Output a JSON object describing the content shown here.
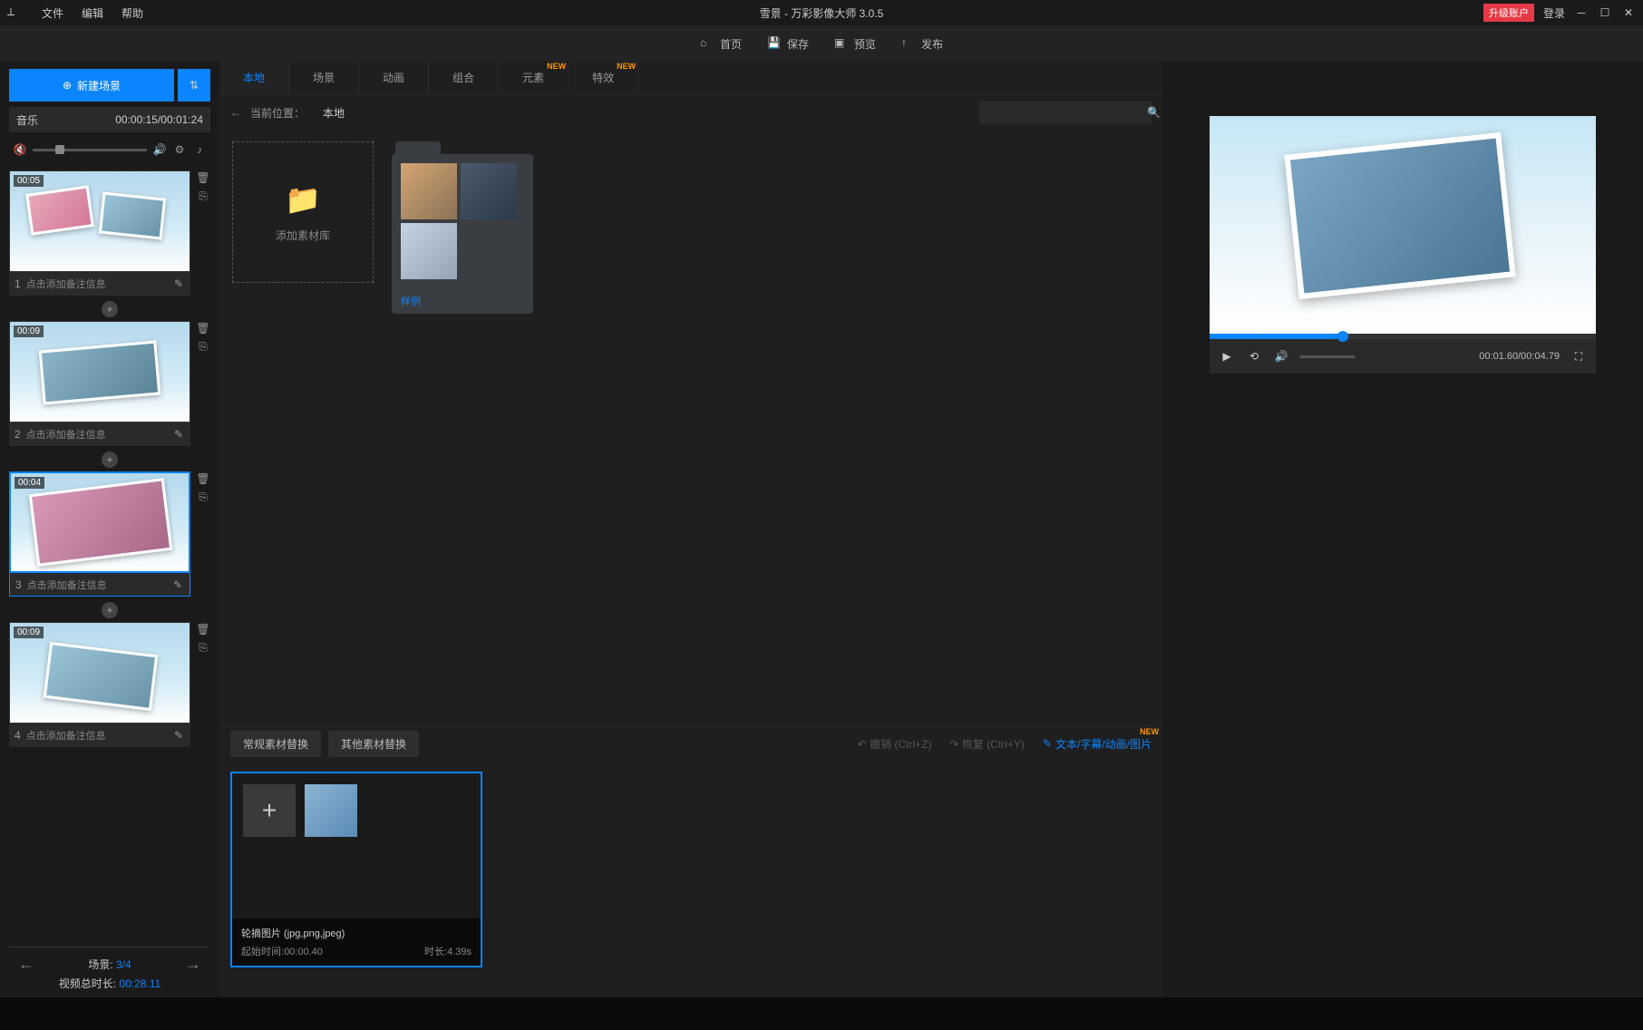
{
  "titlebar": {
    "menus": [
      "文件",
      "编辑",
      "帮助"
    ],
    "title": "雪景 - 万彩影像大师 3.0.5",
    "upgrade": "升级账户",
    "login": "登录"
  },
  "toolbar": {
    "home": "首页",
    "save": "保存",
    "preview": "预览",
    "publish": "发布"
  },
  "sidebar": {
    "new_scene": "新建场景",
    "music_label": "音乐",
    "music_time": "00:00:15/00:01:24",
    "scenes": [
      {
        "time": "00:05",
        "idx": "1",
        "note": "点击添加备注信息"
      },
      {
        "time": "00:09",
        "idx": "2",
        "note": "点击添加备注信息"
      },
      {
        "time": "00:04",
        "idx": "3",
        "note": "点击添加备注信息",
        "selected": true
      },
      {
        "time": "00:09",
        "idx": "4",
        "note": "点击添加备注信息"
      }
    ],
    "footer_scene_label": "场景:",
    "footer_scene_value": "3/4",
    "footer_dur_label": "视频总时长:",
    "footer_dur_value": "00:28.11"
  },
  "center": {
    "tabs": [
      {
        "label": "本地",
        "active": true
      },
      {
        "label": "场景"
      },
      {
        "label": "动画"
      },
      {
        "label": "组合"
      },
      {
        "label": "元素",
        "new": true
      },
      {
        "label": "特效",
        "new": true
      }
    ],
    "bc_label": "当前位置：",
    "bc_loc": "本地",
    "add_asset": "添加素材库",
    "folder_name": "样例"
  },
  "bottom": {
    "tabs": [
      "常规素材替换",
      "其他素材替换"
    ],
    "undo": "撤销 (Ctrl+Z)",
    "redo": "恢复 (Ctrl+Y)",
    "text_link": "文本/字幕/动画/图片",
    "clip_title": "轮摘图片  (jpg,png,jpeg)",
    "clip_start_label": "起始时间:",
    "clip_start_value": "00:00.40",
    "clip_dur_label": "时长:",
    "clip_dur_value": "4.39s"
  },
  "preview": {
    "time": "00:01.60/00:04.79"
  },
  "badges": {
    "new": "NEW"
  }
}
